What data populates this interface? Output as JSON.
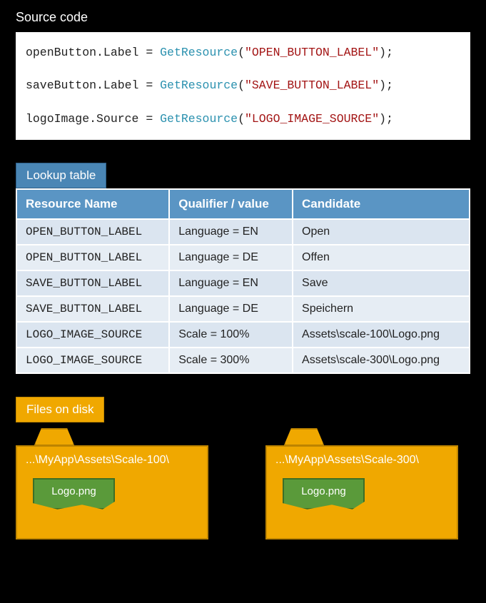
{
  "source": {
    "title": "Source code",
    "lines": [
      {
        "lhs": "openButton.Label = ",
        "fn": "GetResource",
        "arg": "\"OPEN_BUTTON_LABEL\""
      },
      {
        "lhs": "saveButton.Label = ",
        "fn": "GetResource",
        "arg": "\"SAVE_BUTTON_LABEL\""
      },
      {
        "lhs": "logoImage.Source = ",
        "fn": "GetResource",
        "arg": "\"LOGO_IMAGE_SOURCE\""
      }
    ]
  },
  "lookup": {
    "badge": "Lookup table",
    "headers": {
      "name": "Resource Name",
      "qual": "Qualifier / value",
      "cand": "Candidate"
    },
    "rows": [
      {
        "name": "OPEN_BUTTON_LABEL",
        "qual": "Language = EN",
        "cand": "Open"
      },
      {
        "name": "OPEN_BUTTON_LABEL",
        "qual": "Language = DE",
        "cand": "Offen"
      },
      {
        "name": "SAVE_BUTTON_LABEL",
        "qual": "Language = EN",
        "cand": "Save"
      },
      {
        "name": "SAVE_BUTTON_LABEL",
        "qual": "Language = DE",
        "cand": "Speichern"
      },
      {
        "name": "LOGO_IMAGE_SOURCE",
        "qual": "Scale = 100%",
        "cand": "Assets\\scale-100\\Logo.png"
      },
      {
        "name": "LOGO_IMAGE_SOURCE",
        "qual": "Scale = 300%",
        "cand": "Assets\\scale-300\\Logo.png"
      }
    ]
  },
  "files": {
    "badge": "Files on disk",
    "folders": [
      {
        "path": "...\\MyApp\\Assets\\Scale-100\\",
        "file": "Logo.png"
      },
      {
        "path": "...\\MyApp\\Assets\\Scale-300\\",
        "file": "Logo.png"
      }
    ]
  }
}
